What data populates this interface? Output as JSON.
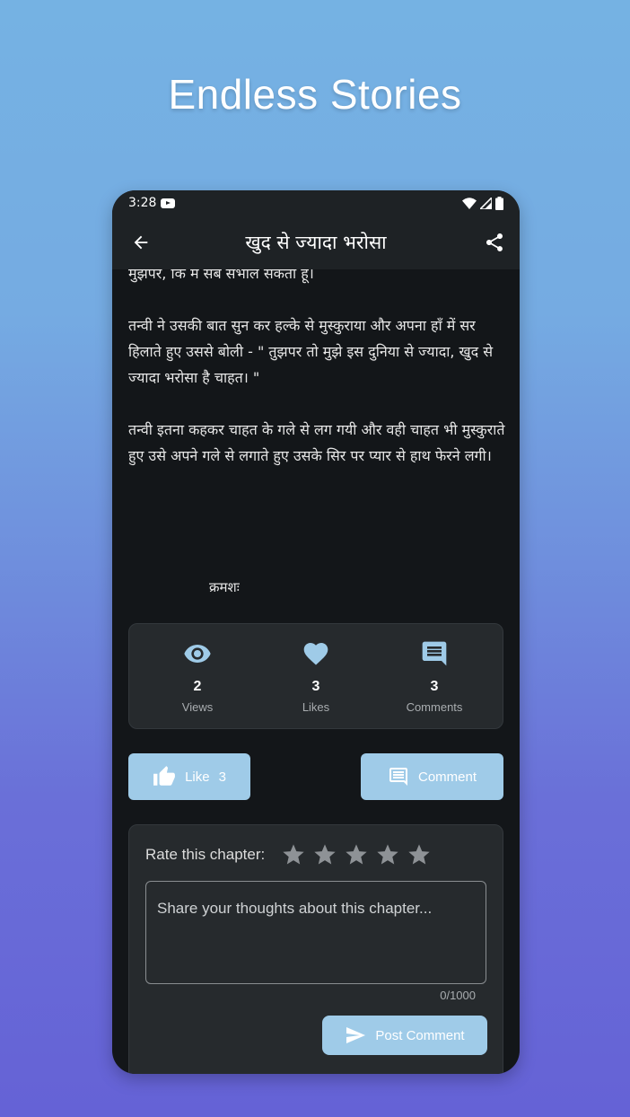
{
  "hero": {
    "title": "Endless Stories"
  },
  "status_bar": {
    "time": "3:28"
  },
  "app_bar": {
    "title": "खुद से ज्यादा भरोसा"
  },
  "story": {
    "paragraphs": [
      "मुझपर, कि मैं सब संभाल सकता हूं।",
      " तन्वी ने उसकी बात सुन कर हल्के से मुस्कुराया और अपना हाँ में सर हिलाते हुए उससे बोली - \" तुझपर तो मुझे इस दुनिया से ज्यादा, खुद से ज्यादा भरोसा है चाहत। \"",
      "तन्वी इतना कहकर चाहत के गले से लग गयी और वही चाहत भी मुस्कुराते हुए उसे अपने गले से लगाते हुए उसके सिर पर प्यार से हाथ फेरने लगी।"
    ],
    "continued": "क्रमशः"
  },
  "stats": {
    "views": {
      "count": "2",
      "label": "Views"
    },
    "likes": {
      "count": "3",
      "label": "Likes"
    },
    "comments": {
      "count": "3",
      "label": "Comments"
    }
  },
  "actions": {
    "like_label": "Like",
    "like_count": "3",
    "comment_label": "Comment"
  },
  "rating": {
    "label": "Rate this chapter:",
    "stars": 5,
    "selected": 0
  },
  "comment_form": {
    "placeholder": "Share your thoughts about this chapter...",
    "value": "",
    "char_count": "0/1000",
    "post_label": "Post Comment"
  },
  "colors": {
    "accent": "#9fcbe8",
    "card": "#262a2d",
    "background": "#131619",
    "star_inactive": "#8e9296"
  }
}
